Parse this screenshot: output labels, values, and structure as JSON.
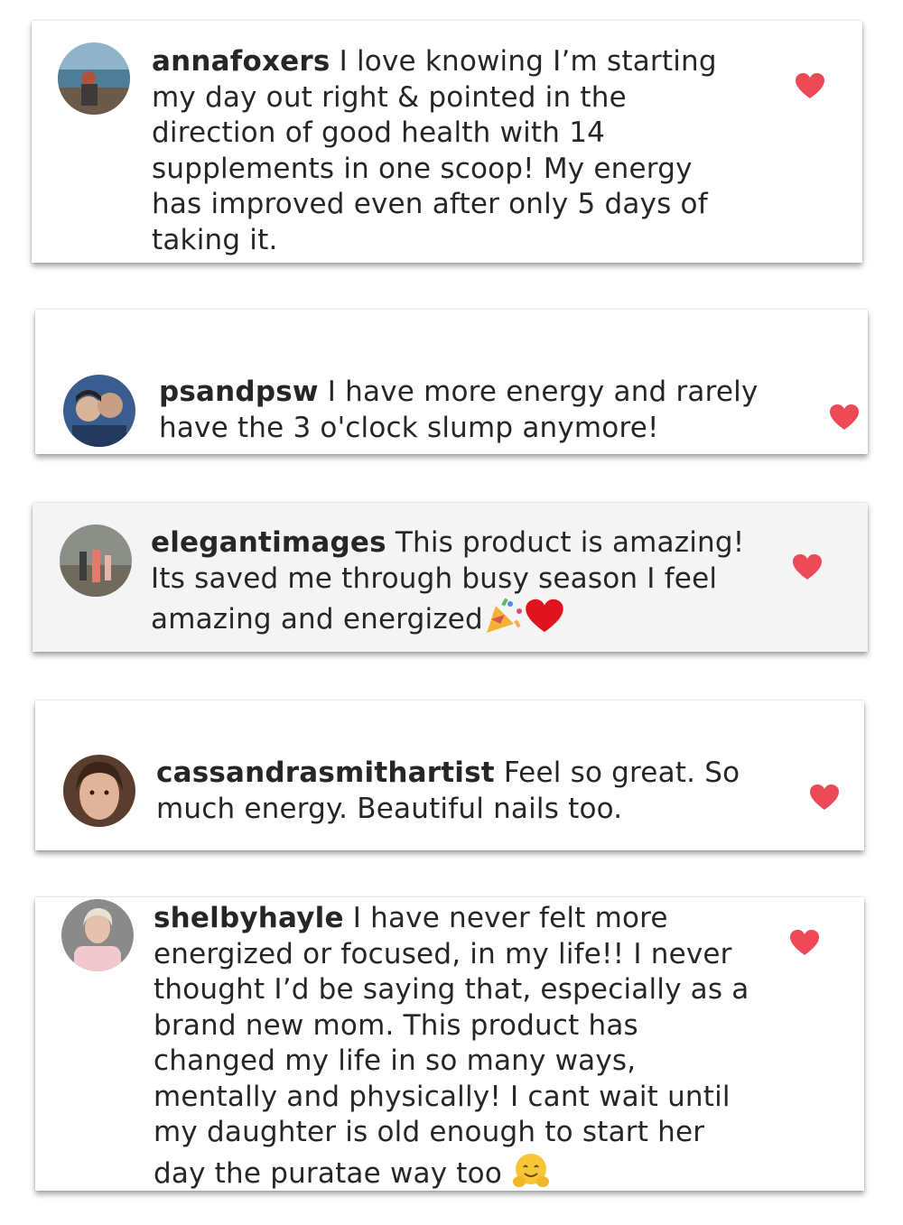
{
  "colors": {
    "heart": "#ed4956",
    "text": "#262626",
    "card_white": "#ffffff",
    "card_grey": "#f4f4f4"
  },
  "comments": [
    {
      "username": "annafoxers",
      "text": "I love knowing I’m starting my day out right & pointed in the direction of good health with 14 supplements in one scoop! My energy has improved even after only 5 days of taking it.",
      "liked": true
    },
    {
      "username": "psandpsw",
      "text": "I have more energy and rarely have the 3 o'clock slump anymore!",
      "liked": true
    },
    {
      "username": "elegantimages",
      "text": "This product is amazing! Its saved me through busy season I feel amazing and energized",
      "emojis": [
        "party-popper",
        "red-heart"
      ],
      "liked": true
    },
    {
      "username": "cassandrasmithartist",
      "text": "Feel so great. So much energy. Beautiful nails too.",
      "liked": true
    },
    {
      "username": "shelbyhayle",
      "text": "I have never felt more energized or focused, in my life!! I never thought I’d be saying that, especially as a brand new mom. This product has changed my life in so many ways, mentally and physically! I cant wait until my daughter is old enough to start her day the puratae way too",
      "emojis": [
        "hugging-face"
      ],
      "liked": true
    }
  ]
}
